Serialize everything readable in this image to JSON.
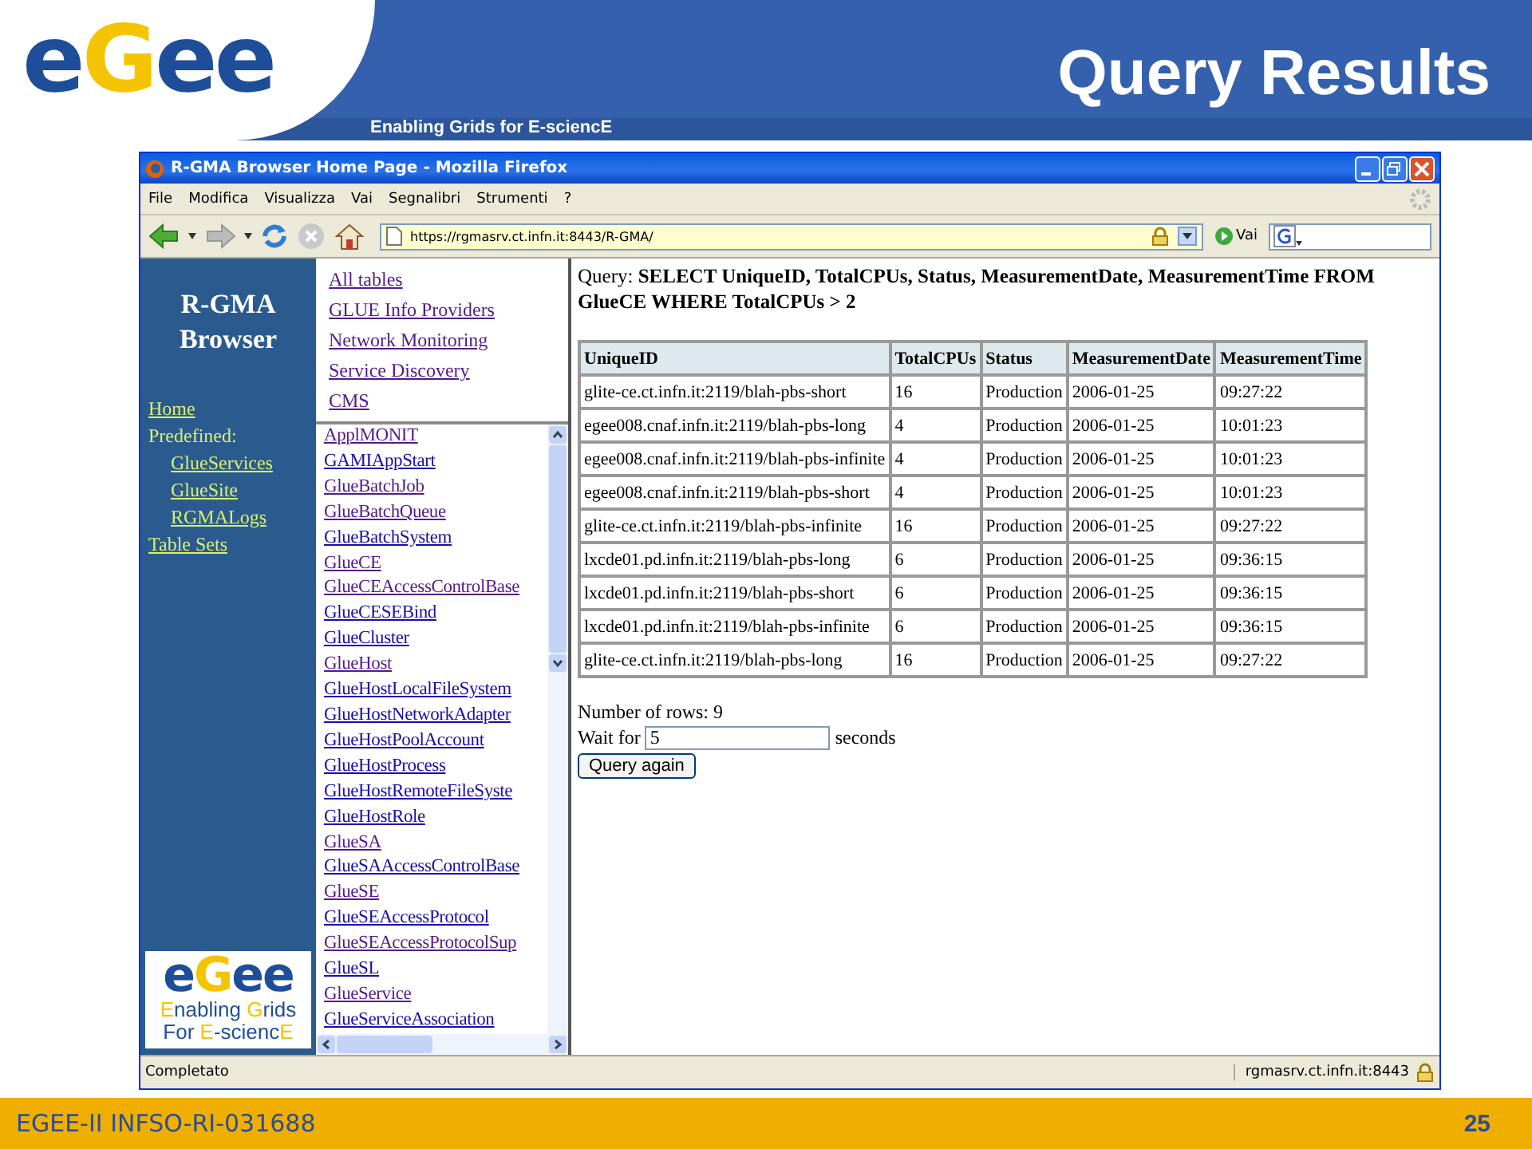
{
  "slide": {
    "logo_letters": [
      {
        "text": "e",
        "color": "#1e4e9a"
      },
      {
        "text": "G",
        "color": "#f5c400"
      },
      {
        "text": "e",
        "color": "#1e4e9a"
      },
      {
        "text": "e",
        "color": "#1e4e9a"
      }
    ],
    "tagline": "Enabling Grids for E-sciencE",
    "title": "Query Results",
    "footer": "EGEE-II INFSO-RI-031688",
    "page_number": "25"
  },
  "browser": {
    "title": "R-GMA Browser Home Page - Mozilla Firefox",
    "menu": [
      "File",
      "Modifica",
      "Visualizza",
      "Vai",
      "Segnalibri",
      "Strumenti",
      "?"
    ],
    "address": "https://rgmasrv.ct.infn.it:8443/R-GMA/",
    "go_label": "Vai",
    "status": "Completato",
    "status_host": "rgmasrv.ct.infn.it:8443"
  },
  "sidebar": {
    "heading": "R-GMA Browser",
    "nav": [
      {
        "label": "Home",
        "kind": "link"
      },
      {
        "label": "Predefined:",
        "kind": "label",
        "children": [
          {
            "label": "GlueServices"
          },
          {
            "label": "GlueSite"
          },
          {
            "label": "RGMALogs"
          }
        ]
      },
      {
        "label": "Table Sets",
        "kind": "link"
      }
    ],
    "logo_letters": [
      {
        "text": "e",
        "color": "#1e4e9a"
      },
      {
        "text": "G",
        "color": "#f5c400"
      },
      {
        "text": "e",
        "color": "#1e4e9a"
      },
      {
        "text": "e",
        "color": "#1e4e9a"
      }
    ],
    "logo_lines": [
      "**E**nabling **G**rids",
      "For **E**-scienc**E**"
    ]
  },
  "categories": [
    {
      "label": "All tables",
      "visited": true
    },
    {
      "label": "GLUE Info Providers",
      "visited": true
    },
    {
      "label": "Network Monitoring",
      "visited": true
    },
    {
      "label": "Service Discovery",
      "visited": true
    },
    {
      "label": "CMS",
      "visited": true
    }
  ],
  "tables": [
    {
      "label": "ApplMONIT",
      "visited": true
    },
    {
      "label": "GAMIAppStart",
      "visited": false
    },
    {
      "label": "GlueBatchJob",
      "visited": true
    },
    {
      "label": "GlueBatchQueue",
      "visited": true
    },
    {
      "label": "GlueBatchSystem",
      "visited": false
    },
    {
      "label": "GlueCE",
      "visited": true
    },
    {
      "label": "GlueCEAccessControlBase",
      "visited": true
    },
    {
      "label": "GlueCESEBind",
      "visited": false
    },
    {
      "label": "GlueCluster",
      "visited": false
    },
    {
      "label": "GlueHost",
      "visited": true
    },
    {
      "label": "GlueHostLocalFileSystem",
      "visited": false
    },
    {
      "label": "GlueHostNetworkAdapter",
      "visited": false
    },
    {
      "label": "GlueHostPoolAccount",
      "visited": false
    },
    {
      "label": "GlueHostProcess",
      "visited": false
    },
    {
      "label": "GlueHostRemoteFileSyste",
      "visited": false
    },
    {
      "label": "GlueHostRole",
      "visited": false
    },
    {
      "label": "GlueSA",
      "visited": true
    },
    {
      "label": "GlueSAAccessControlBase",
      "visited": false
    },
    {
      "label": "GlueSE",
      "visited": true
    },
    {
      "label": "GlueSEAccessProtocol",
      "visited": false
    },
    {
      "label": "GlueSEAccessProtocolSup",
      "visited": true
    },
    {
      "label": "GlueSL",
      "visited": false
    },
    {
      "label": "GlueService",
      "visited": true
    },
    {
      "label": "GlueServiceAssociation",
      "visited": false
    }
  ],
  "query": "Query: **SELECT UniqueID, TotalCPUs, Status, MeasurementDate, MeasurementTime FROM GlueCE WHERE TotalCPUs > 2**",
  "table": {
    "columns": [
      "UniqueID",
      "TotalCPUs",
      "Status",
      "MeasurementDate",
      "MeasurementTime"
    ],
    "rows": [
      [
        "glite-ce.ct.infn.it:2119/blah-pbs-short",
        "16",
        "Production",
        "2006-01-25",
        "09:27:22"
      ],
      [
        "egee008.cnaf.infn.it:2119/blah-pbs-long",
        "4",
        "Production",
        "2006-01-25",
        "10:01:23"
      ],
      [
        "egee008.cnaf.infn.it:2119/blah-pbs-infinite",
        "4",
        "Production",
        "2006-01-25",
        "10:01:23"
      ],
      [
        "egee008.cnaf.infn.it:2119/blah-pbs-short",
        "4",
        "Production",
        "2006-01-25",
        "10:01:23"
      ],
      [
        "glite-ce.ct.infn.it:2119/blah-pbs-infinite",
        "16",
        "Production",
        "2006-01-25",
        "09:27:22"
      ],
      [
        "lxcde01.pd.infn.it:2119/blah-pbs-long",
        "6",
        "Production",
        "2006-01-25",
        "09:36:15"
      ],
      [
        "lxcde01.pd.infn.it:2119/blah-pbs-short",
        "6",
        "Production",
        "2006-01-25",
        "09:36:15"
      ],
      [
        "lxcde01.pd.infn.it:2119/blah-pbs-infinite",
        "6",
        "Production",
        "2006-01-25",
        "09:36:15"
      ],
      [
        "glite-ce.ct.infn.it:2119/blah-pbs-long",
        "16",
        "Production",
        "2006-01-25",
        "09:27:22"
      ]
    ]
  },
  "row_count": "Number of rows: 9",
  "wait_label": "Wait for",
  "wait_value": "5",
  "wait_unit": "seconds",
  "button": "Query again"
}
